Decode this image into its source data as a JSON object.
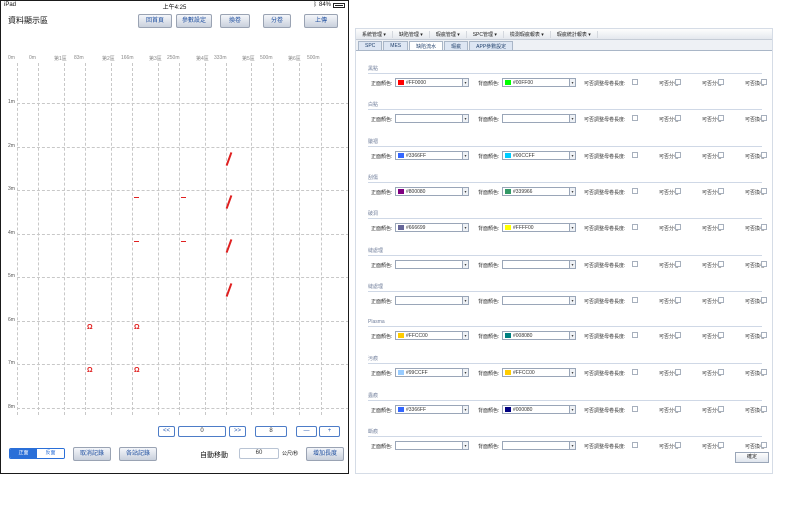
{
  "ipad": {
    "status": {
      "device": "iPad",
      "time": "上午4:25",
      "battery": "84%"
    },
    "title": "資料顯示區",
    "toolbar": [
      "回首頁",
      "參數設定",
      "換卷",
      "分卷",
      "上傳"
    ],
    "ruler": [
      "0m",
      "0m",
      "第1區",
      "83m",
      "第2區",
      "166m",
      "第3區",
      "250m",
      "第4區",
      "333m",
      "第5區",
      "500m",
      "第6區",
      "500m"
    ],
    "y_labels": [
      "1m",
      "2m",
      "3m",
      "4m",
      "5m",
      "6m",
      "7m",
      "8m"
    ],
    "pager": {
      "prev": "<<",
      "page": "0",
      "next": ">>",
      "count": "8",
      "minus": "—",
      "plus": "+"
    },
    "bottom": {
      "face_front": "正面",
      "face_back": "反面",
      "cancel_record": "取消記錄",
      "station_record": "各站記錄",
      "auto_move": "自動移動",
      "speed": "60",
      "speed_unit": "公尺/秒",
      "add_length": "增加長度"
    }
  },
  "settings": {
    "menu": [
      "系統管理 ▾",
      "缺陷管理 ▾",
      "瑕疵管理 ▾",
      "SPC管理 ▾",
      "檢測瑕疵報表 ▾",
      "瑕疵統計報表 ▾"
    ],
    "tabs": [
      "SPC",
      "MES",
      "缺陷流水",
      "瑕疵",
      "APP參數設定"
    ],
    "labels": {
      "front_color": "正面顏色:",
      "back_color": "背面顏色:",
      "adjust_length": "可否調整母卷長度:",
      "can_split": "可否分卷:",
      "can_divide": "可否分卷:",
      "can_change": "可否換卷:"
    },
    "groups": [
      {
        "title": "黑點",
        "front": "#FF0000",
        "front_color": "#FF0000",
        "back": "#00FF00",
        "back_color": "#00FF00"
      },
      {
        "title": "白點",
        "front": "",
        "front_color": "",
        "back": "",
        "back_color": ""
      },
      {
        "title": "皺褶",
        "front": "#3366FF",
        "front_color": "#3366FF",
        "back": "#00CCFF",
        "back_color": "#00CCFF"
      },
      {
        "title": "刮傷",
        "front": "#800080",
        "front_color": "#800080",
        "back": "#339966",
        "back_color": "#339966"
      },
      {
        "title": "破洞",
        "front": "#666699",
        "front_color": "#666699",
        "back": "#FFFF00",
        "back_color": "#FFFF00"
      },
      {
        "title": "縫處理",
        "front": "",
        "front_color": "",
        "back": "",
        "back_color": ""
      },
      {
        "title": "縫處理",
        "front": "",
        "front_color": "",
        "back": "",
        "back_color": ""
      },
      {
        "title": "Plasma",
        "front": "#FFCC00",
        "front_color": "#FFCC00",
        "back": "#008080",
        "back_color": "#008080"
      },
      {
        "title": "污痕",
        "front": "#99CCFF",
        "front_color": "#99CCFF",
        "back": "#FFCC00",
        "back_color": "#FFCC00"
      },
      {
        "title": "蟲痕",
        "front": "#3366FF",
        "front_color": "#3366FF",
        "back": "#000080",
        "back_color": "#000080"
      },
      {
        "title": "斷痕",
        "front": "",
        "front_color": "",
        "back": "",
        "back_color": ""
      }
    ],
    "ok": "確定"
  }
}
